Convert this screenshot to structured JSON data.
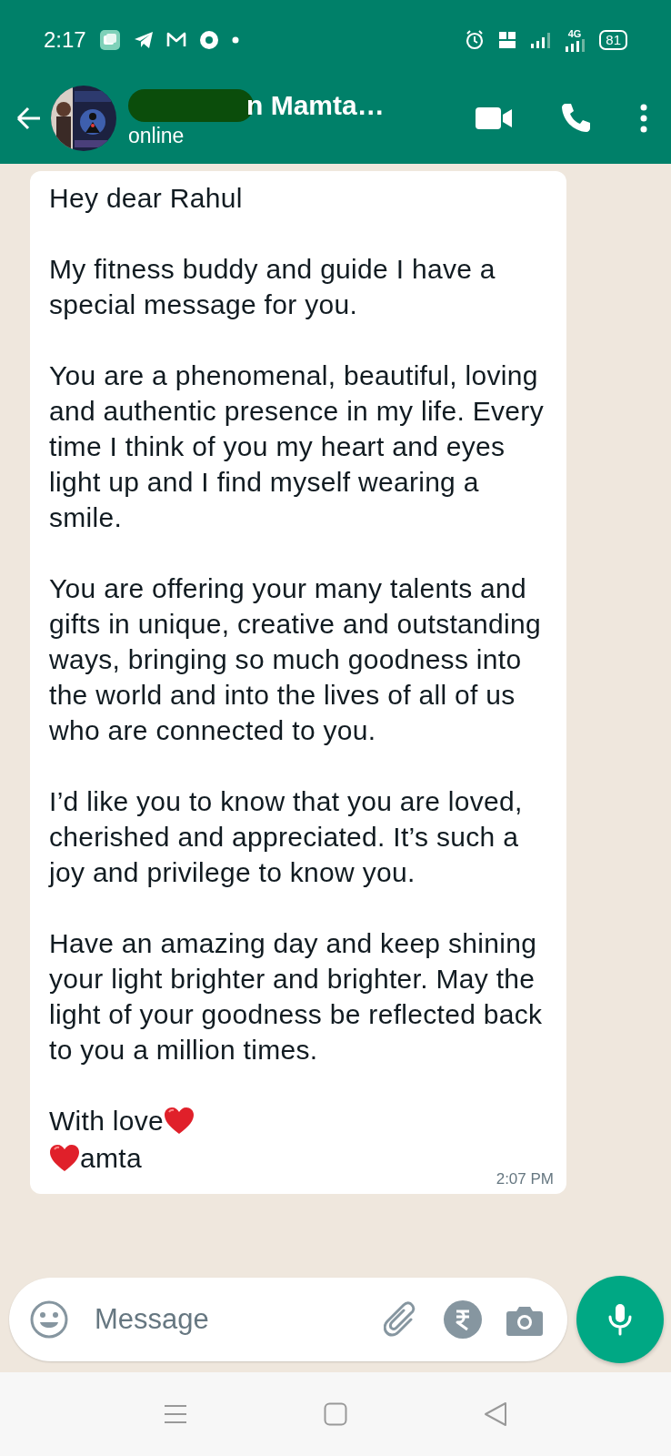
{
  "status_bar": {
    "time": "2:17",
    "network": "4G",
    "battery": "81"
  },
  "header": {
    "title": "n Mamta…",
    "title_redacted": true,
    "subtitle": "online"
  },
  "message": {
    "paragraphs": [
      "Hey dear Rahul",
      "My fitness buddy and guide I have a special message for you.",
      "You are a phenomenal, beautiful, loving and authentic presence in my life. Every time I think of you my heart and eyes light up and I find myself wearing a smile.",
      "You are offering your many talents and gifts in unique, creative and outstanding ways, bringing so much goodness into the world and into the lives of all of us who are connected to you.",
      "I’d like you to know that you are loved, cherished and appreciated. It’s such a joy and privilege to know you.",
      "Have an amazing day and keep shining your light brighter and brighter. May the light of your goodness be reflected back to you a million times."
    ],
    "signoff": [
      {
        "text": "With love",
        "kind": "heart_after"
      },
      {
        "text": "amta",
        "kind": "heart_before"
      }
    ],
    "time": "2:07 PM"
  },
  "composer": {
    "placeholder": "Message"
  }
}
